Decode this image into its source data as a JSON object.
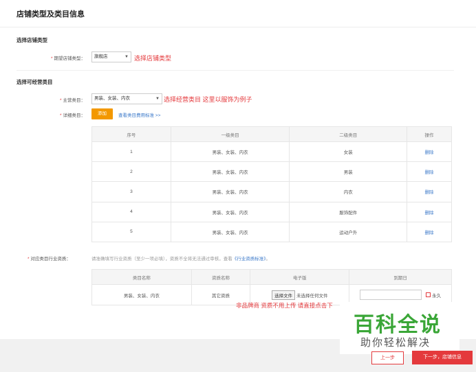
{
  "page": {
    "title": "店铺类型及类目信息"
  },
  "shop_type": {
    "section_title": "选择店铺类型",
    "label": "期望店铺类型：",
    "value": "旗舰店",
    "annotation": "选择店铺类型"
  },
  "category": {
    "section_title": "选择可经营类目",
    "main_label": "主营类目：",
    "main_value": "男装、女装、内衣",
    "main_annotation": "选择经营类目 这里以服饰为例子",
    "detail_label": "详细类目：",
    "add_button": "添加",
    "rate_link": "查看类目费用标准 >>",
    "table": {
      "headers": [
        "序号",
        "一级类目",
        "二级类目",
        "操作"
      ],
      "rows": [
        {
          "no": "1",
          "level1": "男装、女装、内衣",
          "level2": "女装",
          "action": "删除"
        },
        {
          "no": "2",
          "level1": "男装、女装、内衣",
          "level2": "男装",
          "action": "删除"
        },
        {
          "no": "3",
          "level1": "男装、女装、内衣",
          "level2": "内衣",
          "action": "删除"
        },
        {
          "no": "4",
          "level1": "男装、女装、内衣",
          "level2": "服饰配件",
          "action": "删除"
        },
        {
          "no": "5",
          "level1": "男装、女装、内衣",
          "level2": "运动户外",
          "action": "删除"
        }
      ]
    }
  },
  "qualification": {
    "label": "对应类目行业资质：",
    "note_prefix": "请准确填写行业资质（至少一项必填），资质不全将无法通过审核，查看",
    "note_link": "《行业资质标准》",
    "note_suffix": "。",
    "table": {
      "headers": [
        "类目名称",
        "资质名称",
        "电子版",
        "到期日"
      ],
      "row": {
        "category": "男装、女装、内衣",
        "qual_name": "其它资质",
        "file_button": "选择文件",
        "file_status": "未选择任何文件",
        "permanent": "永久"
      }
    },
    "bottom_annotation": "非品牌商 资质不用上传 请直接点击下"
  },
  "watermark": {
    "big": "百科全说",
    "small": "助你轻松解决"
  },
  "footer": {
    "prev": "上一步",
    "next": "下一步，店铺信息"
  },
  "colors": {
    "accent_red": "#e4393c",
    "link_blue": "#3a78c9",
    "add_orange": "#f39800",
    "watermark_green": "#3aa637"
  }
}
